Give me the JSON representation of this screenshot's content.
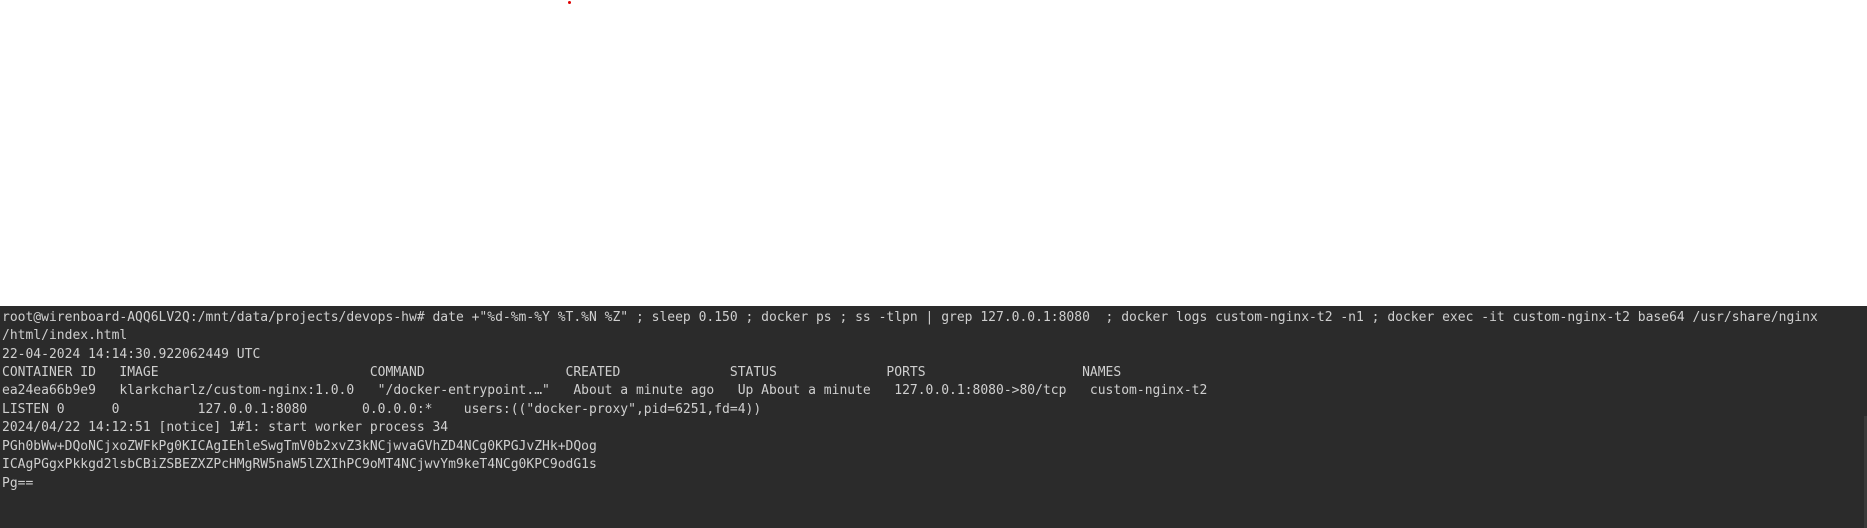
{
  "terminal": {
    "lines": [
      "root@wirenboard-AQQ6LV2Q:/mnt/data/projects/devops-hw# date +\"%d-%m-%Y %T.%N %Z\" ; sleep 0.150 ; docker ps ; ss -tlpn | grep 127.0.0.1:8080  ; docker logs custom-nginx-t2 -n1 ; docker exec -it custom-nginx-t2 base64 /usr/share/nginx",
      "/html/index.html",
      "22-04-2024 14:14:30.922062449 UTC",
      "CONTAINER ID   IMAGE                           COMMAND                  CREATED              STATUS              PORTS                    NAMES",
      "ea24ea66b9e9   klarkcharlz/custom-nginx:1.0.0   \"/docker-entrypoint.…\"   About a minute ago   Up About a minute   127.0.0.1:8080->80/tcp   custom-nginx-t2",
      "LISTEN 0      0          127.0.0.1:8080       0.0.0.0:*    users:((\"docker-proxy\",pid=6251,fd=4))",
      "2024/04/22 14:12:51 [notice] 1#1: start worker process 34",
      "PGh0bWw+DQoNCjxoZWFkPg0KICAgIEhleSwgTmV0b2xvZ3kNCjwvaGVhZD4NCg0KPGJvZHk+DQog",
      "ICAgPGgxPkkgd2lsbCBiZSBEZXZPcHMgRW5naW5lZXIhPC9oMT4NCjwvYm9keT4NCg0KPC9odG1s",
      "Pg=="
    ]
  }
}
